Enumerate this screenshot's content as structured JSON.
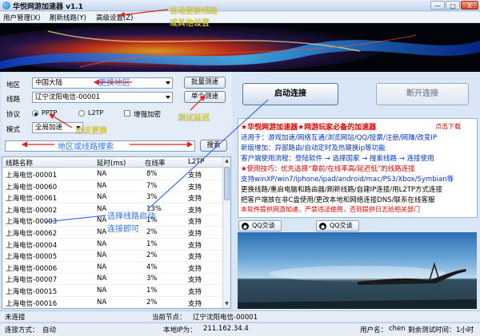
{
  "window": {
    "title": "华悦网游加速器 v1.1",
    "min": "—",
    "max": "□",
    "close": "X"
  },
  "menu": [
    "用户管理(X)",
    "刷新线路(Y)",
    "高级设置(Z)"
  ],
  "form": {
    "region_label": "地区",
    "region_value": "中国大陆",
    "line_label": "线路",
    "line_value": "辽宁沈阳电信-00001",
    "protocol_label": "协议",
    "proto_pptp": "PPTP",
    "proto_l2tp": "L2TP",
    "encrypt_label": "增强加密",
    "mode_label": "模式",
    "mode_value": "全局加速",
    "batch_test": "批量测速",
    "single_test": "单个测速",
    "search_value": "",
    "search_button": "搜索"
  },
  "table": {
    "headers": [
      "线路名称",
      "延时(ms)",
      "在线率",
      "L2TP"
    ],
    "rows": [
      [
        "上海电信-00001",
        "NA",
        "8%",
        "支持"
      ],
      [
        "上海电信-00060",
        "NA",
        "7%",
        "支持"
      ],
      [
        "上海电信-00061",
        "NA",
        "3%",
        "支持"
      ],
      [
        "上海电信-00002",
        "NA",
        "13%",
        "支持"
      ],
      [
        "上海电信-00003",
        "NA",
        "1%",
        "支持"
      ],
      [
        "上海电信-00062",
        "NA",
        "2%",
        "支持"
      ],
      [
        "上海电信-00004",
        "NA",
        "1%",
        "支持"
      ],
      [
        "上海电信-00005",
        "NA",
        "2%",
        "支持"
      ],
      [
        "上海电信-00006",
        "NA",
        "4%",
        "支持"
      ],
      [
        "上海电信-00007",
        "NA",
        "3%",
        "支持"
      ],
      [
        "上海电信-00015",
        "NA",
        "1%",
        "支持"
      ],
      [
        "上海电信-00016",
        "NA",
        "2%",
        "支持"
      ]
    ]
  },
  "actions": {
    "start": "启动连接",
    "reconnect": "断开连接"
  },
  "notice": {
    "line1": "★华悦网游加速器★网游玩家必备的加速器",
    "line1_link": "点击下载",
    "line2": "适用于：游戏加速/网络互通/浏览网站/QQ/投票/注册/网赚/改变IP",
    "line3": "新版增加：异部路由/自动定时及热键换ip等功能",
    "line4": "客户端使用流程：登陆软件 → 选择国家 → 搜索线路 → 连接使用",
    "line5": "★使用技巧：优先选择“靠前/在线率高/延迟低”的线路连接",
    "line6": "支持winXP/win7/iphone/ipad/android/mac/PS3/Xbox/Symbian等",
    "line7": "更换线路/重启电脑和路由器/刷新线路/自建IP连接/用L2TP方式连接",
    "line8": "把客户端放在非C盘使用/更改本地和网络连接DNS/联系在线客服",
    "line9": "本软件提供网游加速，严禁违法使用，否则提供日志给相关部门",
    "qq1": "QQ交谈",
    "qq2": "QQ交谈"
  },
  "status": {
    "conn_state": "未连接",
    "current_node_label": "当前节点：",
    "current_node_value": "辽宁沈阳电信-00001",
    "conn_mode_label": "连接方式：",
    "conn_mode_value": "自动",
    "local_ip_label": "本地IP为：",
    "local_ip_value": "211.162.34.4",
    "user_label": "用户名：",
    "user_value": "chen",
    "remaining_label": "剩余测试时间：",
    "remaining_value": "1小时"
  },
  "annotations": {
    "auto_update": "自动更新线路",
    "other_settings": "或其他设置",
    "change_region": "更换地区",
    "test_latency": "测试延迟",
    "protocol_change": "协议更换",
    "search_hint": "地区或线路搜索",
    "select_line": "选择线路启动",
    "connect_now": "连接即可"
  },
  "colors": {
    "annotation_yellow": "#f5e627",
    "annotation_blue": "#2f73ff",
    "notice_red": "#e00000",
    "notice_blue": "#0033cc"
  }
}
